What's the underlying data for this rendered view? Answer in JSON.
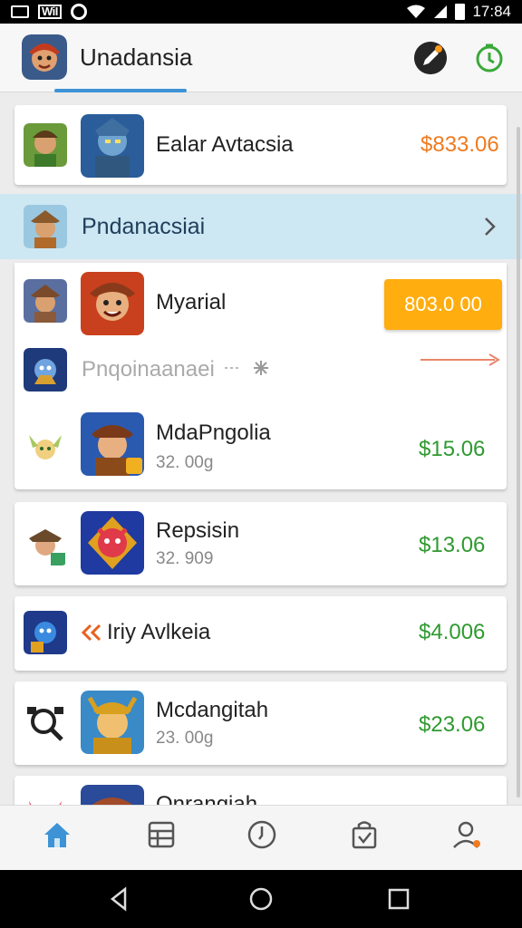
{
  "status_bar": {
    "sim_label": "WiI",
    "time": "17:84"
  },
  "header": {
    "title": "Unadansia"
  },
  "top_item": {
    "name": "Ealar Avtacsia",
    "price": "$833.06"
  },
  "section": {
    "title": "Pndanacsiai"
  },
  "featured": {
    "name": "Myarial",
    "buy_label": "803.0 00",
    "hint": "Pnqoinaanaei"
  },
  "items": [
    {
      "name": "MdaPngolia",
      "sub": "32. 00g",
      "price": "$15.06"
    },
    {
      "name": "Repsisin",
      "sub": "32. 909",
      "price": "$13.06"
    },
    {
      "name": "Iriy Avlkeia",
      "sub": "",
      "price": "$4.006"
    },
    {
      "name": "Mcdangitah",
      "sub": "23. 00g",
      "price": "$23.06"
    },
    {
      "name": "Onrangiah",
      "sub": "",
      "price": ""
    }
  ],
  "colors": {
    "accent": "#3d93d6",
    "buy": "#ffad0f",
    "price_green": "#2f9a2f",
    "price_orange": "#f07a1e",
    "section_bg": "#cde7f3"
  },
  "icons": [
    "home-icon",
    "grid-icon",
    "clock-icon",
    "bag-icon",
    "profile-icon"
  ]
}
